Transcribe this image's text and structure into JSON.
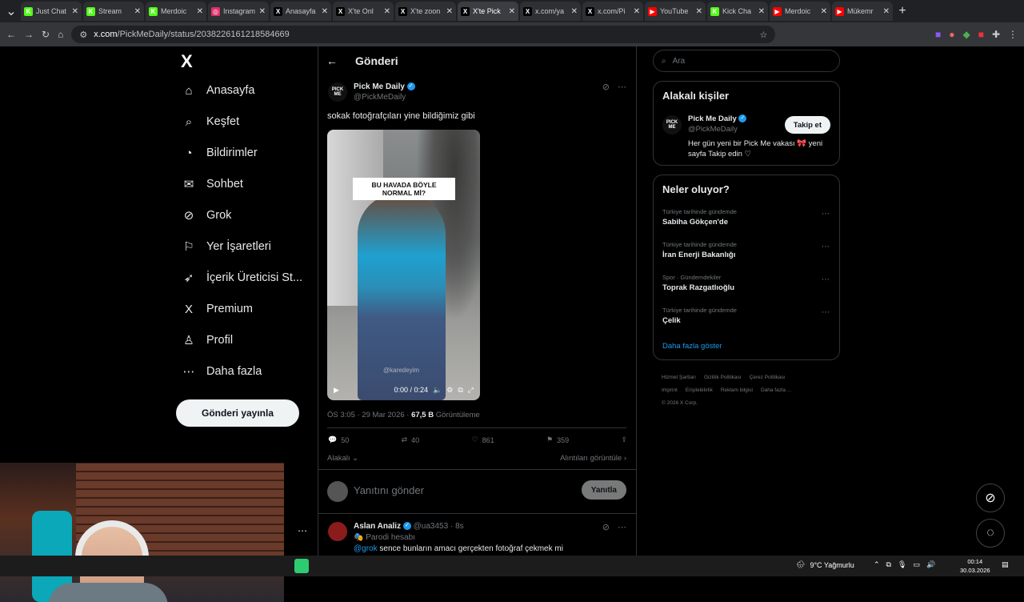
{
  "browser": {
    "tabs": [
      {
        "label": "Just Chat",
        "fav": "K",
        "color": "#53fc18"
      },
      {
        "label": "Stream",
        "fav": "K",
        "color": "#53fc18"
      },
      {
        "label": "Merdoic",
        "fav": "K",
        "color": "#53fc18"
      },
      {
        "label": "Instagram",
        "fav": "◎",
        "color": "#e1306c"
      },
      {
        "label": "Anasayfa",
        "fav": "X",
        "color": "#000000"
      },
      {
        "label": "X'te Onl",
        "fav": "X",
        "color": "#000000"
      },
      {
        "label": "X'te zoon",
        "fav": "X",
        "color": "#000000"
      },
      {
        "label": "X'te Pick",
        "fav": "X",
        "color": "#000000",
        "active": true
      },
      {
        "label": "x.com/ya",
        "fav": "X",
        "color": "#000000"
      },
      {
        "label": "x.com/Pi",
        "fav": "X",
        "color": "#000000"
      },
      {
        "label": "YouTube",
        "fav": "▶",
        "color": "#ff0000"
      },
      {
        "label": "Kick Cha",
        "fav": "K",
        "color": "#53fc18"
      },
      {
        "label": "Merdoic",
        "fav": "▶",
        "color": "#ff0000"
      },
      {
        "label": "Mükemr",
        "fav": "▶",
        "color": "#ff0000"
      }
    ],
    "url_host": "x.com",
    "url_path": "/PickMeDaily/status/2038226161218584669"
  },
  "nav": {
    "logo": "X",
    "items": [
      {
        "label": "Anasayfa",
        "icon": "⌂"
      },
      {
        "label": "Keşfet",
        "icon": "⌕"
      },
      {
        "label": "Bildirimler",
        "icon": "◔"
      },
      {
        "label": "Sohbet",
        "icon": "✉"
      },
      {
        "label": "Grok",
        "icon": "⊘"
      },
      {
        "label": "Yer İşaretleri",
        "icon": "⚐"
      },
      {
        "label": "İçerik Üreticisi St...",
        "icon": "➶"
      },
      {
        "label": "Premium",
        "icon": "X"
      },
      {
        "label": "Profil",
        "icon": "♙"
      },
      {
        "label": "Daha fazla",
        "icon": "⋯"
      }
    ],
    "post_button": "Gönderi yayınla"
  },
  "post": {
    "header_title": "Gönderi",
    "author_name": "Pick Me Daily",
    "author_handle": "@PickMeDaily",
    "avatar_text": "PICK ME",
    "text": "sokak fotoğrafçıları yine bildiğimiz gibi",
    "media_caption": "BU HAVADA BÖYLE NORMAL Mİ?",
    "media_watermark": "@karedeyim",
    "video_time": "0:00 / 0:24",
    "timestamp": "ÖS 3:05 · 29 Mar 2026 · ",
    "views_count": "67,5 B",
    "views_label": " Görüntüleme",
    "replies": "50",
    "reposts": "40",
    "likes": "861",
    "bookmarks": "359",
    "relevance": "Alakalı",
    "quotes_link": "Alıntıları görüntüle",
    "reply_placeholder": "Yanıtını gönder",
    "reply_button": "Yanıtla"
  },
  "reply_post": {
    "author_name": "Aslan Analiz",
    "author_handle": "@ua3453",
    "time": "8s",
    "parody": "Parodi hesabı",
    "mention": "@grok",
    "text": " sence bunların amacı gerçekten fotoğraf çekmek mi"
  },
  "sidebar": {
    "search_placeholder": "Ara",
    "people_title": "Alakalı kişiler",
    "person_name": "Pick Me Daily",
    "person_handle": "@PickMeDaily",
    "follow_button": "Takip et",
    "person_bio": "Her gün yeni bir Pick Me vakası 🎀 yeni sayfa Takip edin ♡",
    "trends_title": "Neler oluyor?",
    "trends": [
      {
        "context": "Türkiye tarihinde gündemde",
        "title": "Sabiha Gökçen'de"
      },
      {
        "context": "Türkiye tarihinde gündemde",
        "title": "İran Enerji Bakanlığı"
      },
      {
        "context": "Spor · Gündemdekiler",
        "title": "Toprak Razgatlıoğlu"
      },
      {
        "context": "Türkiye tarihinde gündemde",
        "title": "Çelik"
      }
    ],
    "show_more": "Daha fazla göster",
    "footer": [
      "Hizmet Şartları",
      "Gizlilik Politikası",
      "Çerez Politikası",
      "Imprint",
      "Erişilebilirlik",
      "Reklam bilgisi",
      "Daha fazla ...",
      "© 2026 X Corp."
    ]
  },
  "taskbar": {
    "weather": "9°C  Yağmurlu",
    "time": "00:14",
    "date": "30.03.2026"
  }
}
